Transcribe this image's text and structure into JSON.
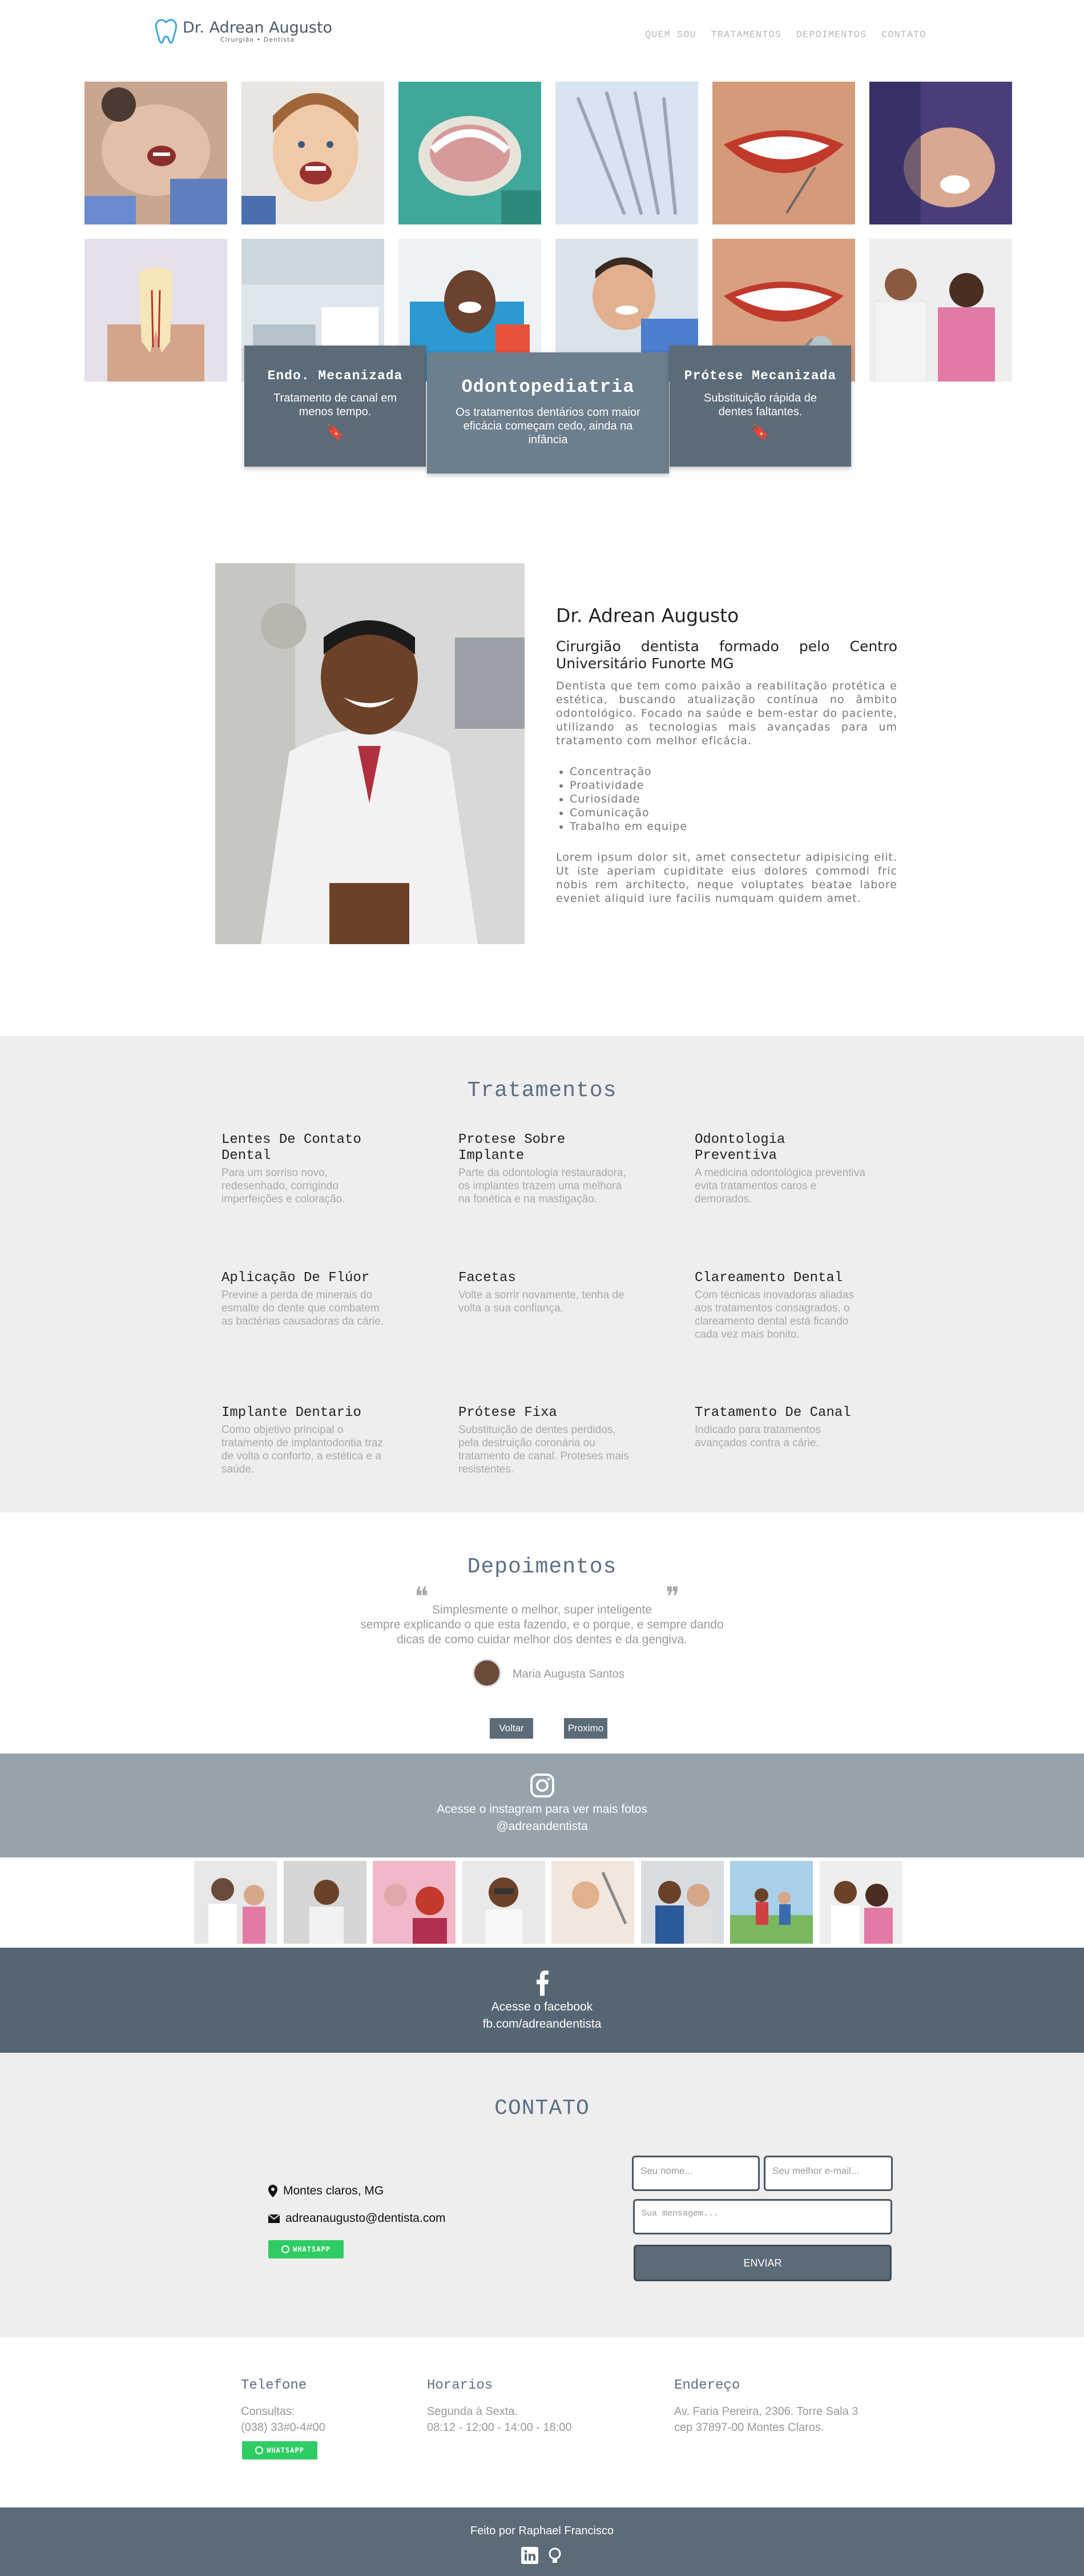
{
  "header": {
    "logo_name": "Dr. Adrean Augusto",
    "logo_sub": "Cirurgião • Dentista",
    "nav": [
      "QUEM SOU",
      "TRATAMENTOS",
      "DEPOIMENTOS",
      "CONTATO"
    ]
  },
  "cards": [
    {
      "title": "Endo. Mecanizada",
      "text": "Tratamento de canal em menos tempo."
    },
    {
      "title": "Odontopediatria",
      "text": "Os tratamentos dentários com maior eficácia começam cedo, ainda na infância"
    },
    {
      "title": "Prótese Mecanizada",
      "text": "Substituição rápida de dentes faltantes."
    }
  ],
  "about": {
    "name": "Dr. Adrean Augusto",
    "subtitle": "Cirurgião dentista formado pelo Centro Universitário Funorte MG",
    "intro": "Dentista que tem como paixão a reabilitação protética e estética, buscando atualização contínua no âmbito odontológico. Focado na saúde e bem-estar do paciente, utilizando as tecnologias mais avançadas para um tratamento com melhor eficácia.",
    "skills": [
      "Concentração",
      "Proatividade",
      "Curiosidade",
      "Comunicação",
      "Trabalho em equipe"
    ],
    "lorem": "Lorem ipsum dolor sit, amet consectetur adipisicing elit. Ut iste aperiam cupiditate eius dolores commodi fric nobis rem architecto, neque voluptates beatae labore eveniet aliquid iure facilis numquam quidem amet."
  },
  "tratamentos": {
    "title": "Tratamentos",
    "items": [
      {
        "title": "Lentes De Contato Dental",
        "text": "Para um sorriso novo, redesenhado, corrigindo imperfeições e coloração."
      },
      {
        "title": "Protese Sobre Implante",
        "text": "Parte da odontologia restauradora, os implantes trazem uma melhora na fonética e na mastigação."
      },
      {
        "title": "Odontologia Preventiva",
        "text": "A medicina odontológica preventiva evita tratamentos caros e demorados."
      },
      {
        "title": "Aplicação De Flúor",
        "text": "Previne a perda de minerais do esmalte do dente que combatem as bactérias causadoras da cárie."
      },
      {
        "title": "Facetas",
        "text": "Volte a sorrir novamente, tenha de volta a sua confiança."
      },
      {
        "title": "Clareamento Dental",
        "text": "Com técnicas inovadoras aliadas aos tratamentos consagrados, o clareamento dental está ficando cada vez mais bonito."
      },
      {
        "title": "Implante Dentario",
        "text": "Como objetivo principal o tratamento de implantodontia traz de volta o conforto, a estética e a saúde."
      },
      {
        "title": "Prótese Fixa",
        "text": "Substituição de dentes perdidos, pela destruição coronária ou tratamento de canal. Proteses mais resistentes."
      },
      {
        "title": "Tratamento De Canal",
        "text": "Indicado para tratamentos avançados contra a cárie."
      }
    ]
  },
  "depoimentos": {
    "title": "Depoimentos",
    "quote_line1": "Simplesmente o melhor, super inteligente",
    "quote_line2": "sempre explicando o que esta fazendo, e o porque, e sempre dando",
    "quote_line3": "dicas de como cuidar melhor dos dentes e da gengiva.",
    "author": "Maria Augusta Santos",
    "prev": "Voltar",
    "next": "Proximo"
  },
  "instagram": {
    "line1": "Acesse o instagram para ver mais fotos",
    "line2": "@adreandentista"
  },
  "facebook": {
    "line1": "Acesse o facebook",
    "line2": "fb.com/adreandentista"
  },
  "contato": {
    "title": "CONTATO",
    "city": "Montes claros, MG",
    "email": "adreanaugusto@dentista.com",
    "whatsapp": "WHATSAPP",
    "name_placeholder": "Seu nome...",
    "email_placeholder": "Seu melhor e-mail...",
    "msg_placeholder": "Sua mensagem...",
    "send": "ENVIAR"
  },
  "info": {
    "tel_title": "Telefone",
    "tel_l1": "Consultas:",
    "tel_l2": "(038) 33#0-4#00",
    "whatsapp": "WHATSAPP",
    "hor_title": "Horarios",
    "hor_l1": "Segunda à Sexta.",
    "hor_l2": "08:12 - 12:00 - 14:00 - 18:00",
    "end_title": "Endereço",
    "end_l1": "Av. Faria Pereira, 2306. Torre Sala 3",
    "end_l2": "cep 37897-00 Montes Claros."
  },
  "footer": {
    "credit": "Feito por Raphael Francisco"
  },
  "colors": {
    "slate": "#5c6b78",
    "light_bg": "#eeeeee",
    "whatsapp": "#2ecc63",
    "insta_bar": "#96a3ad"
  }
}
